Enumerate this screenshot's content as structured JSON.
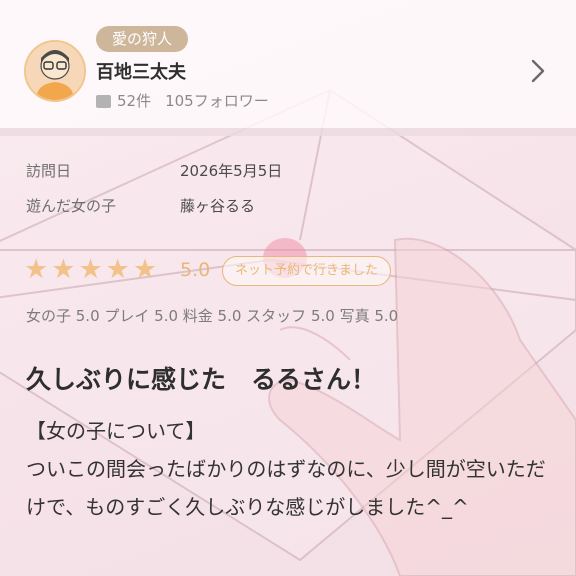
{
  "reviewer": {
    "badge": "愛の狩人",
    "name": "百地三太夫",
    "review_count": "52件",
    "followers": "105フォロワー"
  },
  "details": [
    {
      "label": "訪問日",
      "value": "2026年5月5日"
    },
    {
      "label": "遊んだ女の子",
      "value": "藤ヶ谷るる"
    }
  ],
  "rating": {
    "stars": 5,
    "score": "5.0",
    "method_badge": "ネット予約で行きました",
    "star_color": "#f2c28b"
  },
  "sub_scores": "女の子 5.0 プレイ 5.0 料金 5.0 スタッフ 5.0 写真 5.0",
  "review": {
    "title": "久しぶりに感じた　るるさん！",
    "section_heading": "【女の子について】",
    "body": "ついこの間会ったばかりのはずなのに、少し間が空いただけで、ものすごく久しぶりな感じがしました^_^"
  }
}
